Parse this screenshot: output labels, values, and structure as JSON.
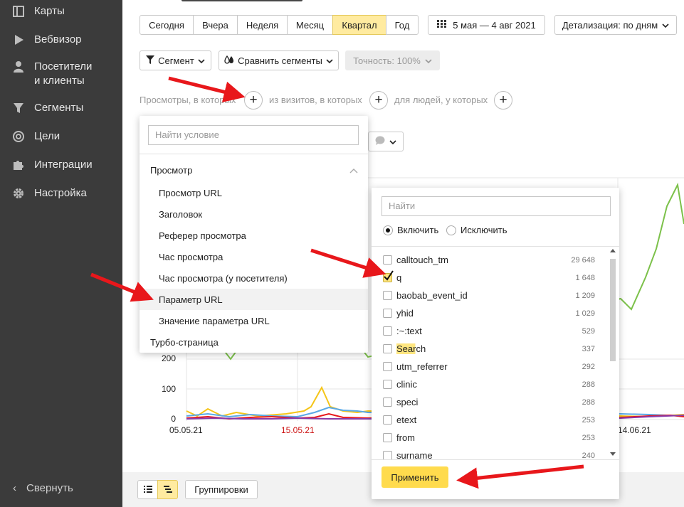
{
  "sidebar": {
    "items": [
      {
        "label": "Карты",
        "icon": "map-icon"
      },
      {
        "label": "Вебвизор",
        "icon": "play-icon"
      },
      {
        "label": "Посетители\nи клиенты",
        "icon": "user-icon"
      },
      {
        "label": "Сегменты",
        "icon": "funnel-icon"
      },
      {
        "label": "Цели",
        "icon": "target-icon"
      },
      {
        "label": "Интеграции",
        "icon": "puzzle-icon"
      },
      {
        "label": "Настройка",
        "icon": "gear-icon"
      }
    ],
    "collapse_label": "Свернуть"
  },
  "period": {
    "buttons": [
      "Сегодня",
      "Вчера",
      "Неделя",
      "Месяц",
      "Квартал",
      "Год"
    ],
    "active": "Квартал",
    "date_range": "5 мая — 4 авг 2021",
    "detail": "Детализация: по дням"
  },
  "toolbar": {
    "segment": "Сегмент",
    "compare": "Сравнить сегменты",
    "accuracy": "Точность: 100%"
  },
  "conditions": {
    "views": "Просмотры, в которых",
    "visits": "из визитов, в которых",
    "people": "для людей, у которых"
  },
  "chart": {
    "y_ticks": [
      "200",
      "100",
      "0"
    ],
    "x_ticks": [
      "05.05.21",
      "15.05.21",
      "14.06.21"
    ]
  },
  "condition_menu": {
    "search_placeholder": "Найти условие",
    "group": "Просмотр",
    "items": [
      "Просмотр URL",
      "Заголовок",
      "Реферер просмотра",
      "Час просмотра",
      "Час просмотра (у посетителя)",
      "Параметр URL",
      "Значение параметра URL"
    ],
    "extra": "Турбо-страница"
  },
  "param_menu": {
    "search_placeholder": "Найти",
    "include": "Включить",
    "exclude": "Исключить",
    "rows": [
      {
        "name": "calltouch_tm",
        "count": "29 648",
        "checked": false
      },
      {
        "name": "q",
        "count": "1 648",
        "checked": true
      },
      {
        "name": "baobab_event_id",
        "count": "1 209",
        "checked": false
      },
      {
        "name": "yhid",
        "count": "1 029",
        "checked": false
      },
      {
        "name": ":~:text",
        "count": "529",
        "checked": false
      },
      {
        "name": "Search",
        "count": "337",
        "checked": false
      },
      {
        "name": "utm_referrer",
        "count": "292",
        "checked": false
      },
      {
        "name": "clinic",
        "count": "288",
        "checked": false
      },
      {
        "name": "speci",
        "count": "288",
        "checked": false
      },
      {
        "name": "etext",
        "count": "253",
        "checked": false
      },
      {
        "name": "from",
        "count": "253",
        "checked": false
      },
      {
        "name": "surname",
        "count": "240",
        "checked": false
      }
    ],
    "apply": "Применить"
  },
  "footer": {
    "grouping": "Группировки"
  },
  "colors": {
    "accent_yellow": "#ffdb4d",
    "arrow_red": "#e8171b",
    "sidebar_bg": "#3b3b3b",
    "green_series": "#7cc14a"
  }
}
